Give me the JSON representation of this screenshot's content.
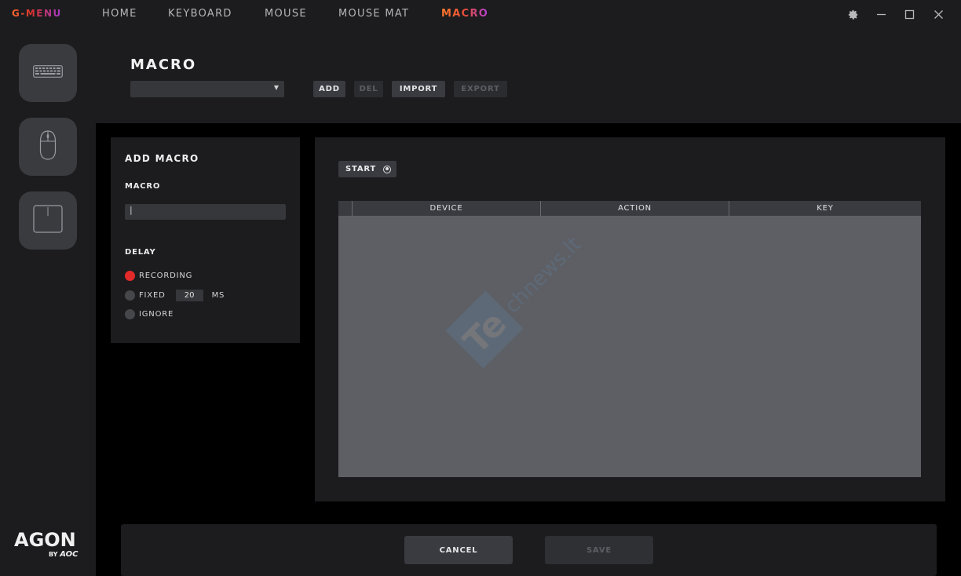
{
  "app": {
    "brand": "G-MENU"
  },
  "nav": {
    "items": [
      {
        "label": "HOME"
      },
      {
        "label": "KEYBOARD"
      },
      {
        "label": "MOUSE"
      },
      {
        "label": "MOUSE MAT"
      },
      {
        "label": "MACRO",
        "active": true
      }
    ]
  },
  "window_controls": [
    "gear-icon",
    "minimize-icon",
    "maximize-icon",
    "close-icon"
  ],
  "sidebar": {
    "devices": [
      "keyboard-icon",
      "mouse-icon",
      "mouse-mat-icon"
    ],
    "logo": {
      "main": "AGON",
      "by": "BY",
      "maker": "AOC"
    }
  },
  "header": {
    "title": "MACRO",
    "select_value": "",
    "buttons": [
      {
        "label": "ADD",
        "enabled": true
      },
      {
        "label": "DEL",
        "enabled": false
      },
      {
        "label": "IMPORT",
        "enabled": true
      },
      {
        "label": "EXPORT",
        "enabled": false
      }
    ]
  },
  "add_macro": {
    "title": "ADD MACRO",
    "macro_label": "MACRO",
    "macro_value": "|",
    "delay_label": "DELAY",
    "options": [
      {
        "label": "RECORDING",
        "selected": true
      },
      {
        "label": "FIXED",
        "selected": false,
        "value": "20",
        "unit": "MS"
      },
      {
        "label": "IGNORE",
        "selected": false
      }
    ]
  },
  "recorder": {
    "start_label": "START",
    "columns": [
      "DEVICE",
      "ACTION",
      "KEY"
    ],
    "rows": []
  },
  "watermark": {
    "text1": "Te",
    "text2": "chnews.lt"
  },
  "footer": {
    "cancel_label": "CANCEL",
    "save_label": "SAVE"
  },
  "colors": {
    "accent_orange": "#ff6a2b",
    "accent_purple": "#a33bd1",
    "record_red": "#e32a2a",
    "panel": "#1c1c1e"
  }
}
